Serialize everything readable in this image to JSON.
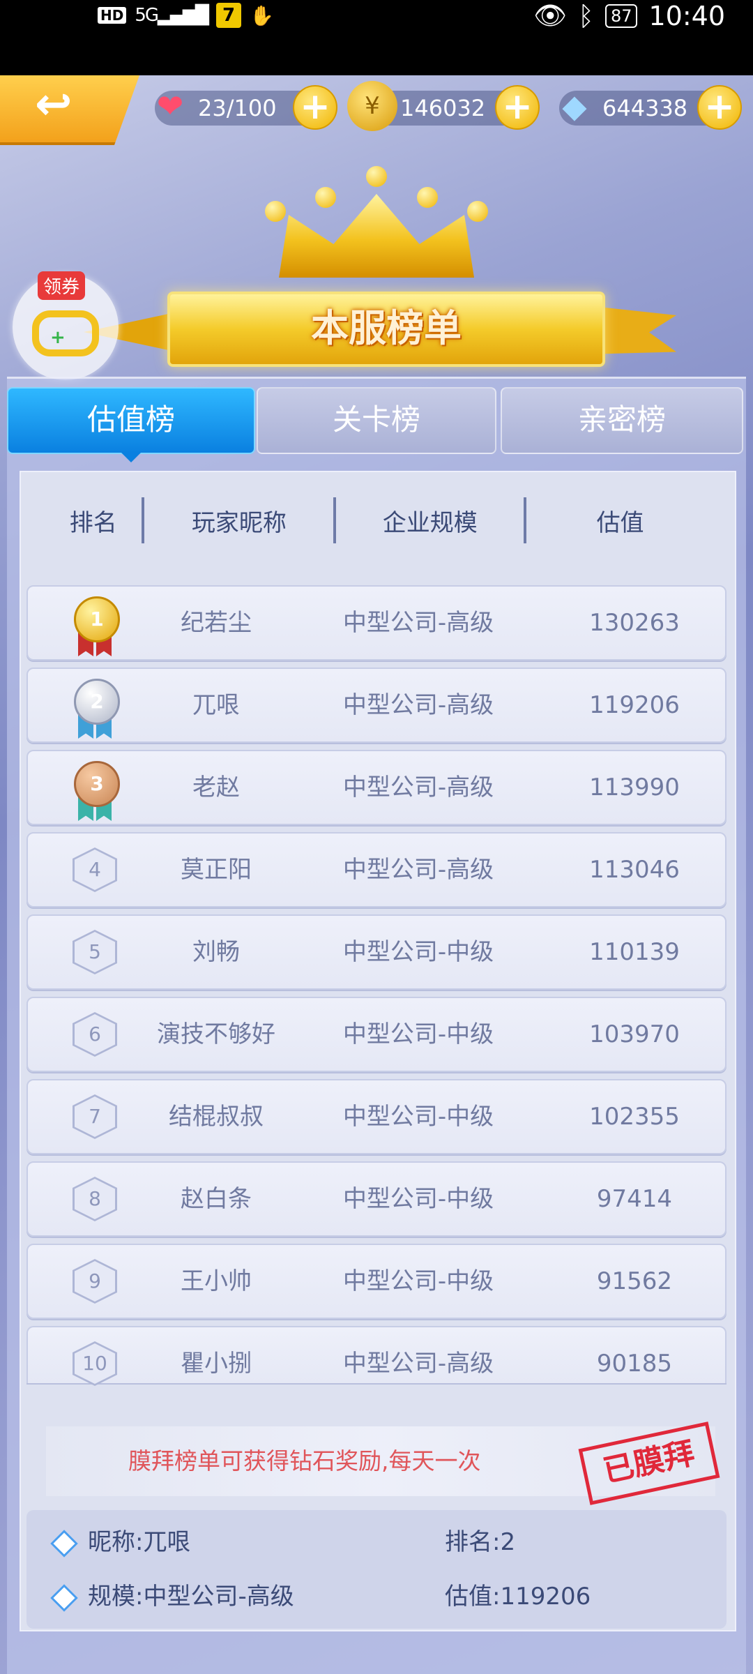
{
  "status_bar": {
    "hd": "HD",
    "signal": "5G",
    "app_badge": "7",
    "battery": "87",
    "time": "10:40"
  },
  "resources": {
    "energy": "23/100",
    "coins": "146032",
    "diamonds": "644338"
  },
  "banner": {
    "title": "本服榜单"
  },
  "coupon": {
    "tag": "领券"
  },
  "tabs": [
    {
      "label": "估值榜",
      "active": true
    },
    {
      "label": "关卡榜",
      "active": false
    },
    {
      "label": "亲密榜",
      "active": false
    }
  ],
  "table": {
    "headers": [
      "排名",
      "玩家昵称",
      "企业规模",
      "估值"
    ],
    "rows": [
      {
        "rank": "1",
        "name": "纪若尘",
        "scale": "中型公司-高级",
        "value": "130263"
      },
      {
        "rank": "2",
        "name": "兀哏",
        "scale": "中型公司-高级",
        "value": "119206"
      },
      {
        "rank": "3",
        "name": "老赵",
        "scale": "中型公司-高级",
        "value": "113990"
      },
      {
        "rank": "4",
        "name": "莫正阳",
        "scale": "中型公司-高级",
        "value": "113046"
      },
      {
        "rank": "5",
        "name": "刘畅",
        "scale": "中型公司-中级",
        "value": "110139"
      },
      {
        "rank": "6",
        "name": "演技不够好",
        "scale": "中型公司-中级",
        "value": "103970"
      },
      {
        "rank": "7",
        "name": "结棍叔叔",
        "scale": "中型公司-中级",
        "value": "102355"
      },
      {
        "rank": "8",
        "name": "赵白条",
        "scale": "中型公司-中级",
        "value": "97414"
      },
      {
        "rank": "9",
        "name": "王小帅",
        "scale": "中型公司-中级",
        "value": "91562"
      },
      {
        "rank": "10",
        "name": "瞿小捌",
        "scale": "中型公司-高级",
        "value": "90185"
      }
    ]
  },
  "notice": {
    "text": "膜拜榜单可获得钻石奖励,每天一次",
    "stamp": "已膜拜"
  },
  "my_info": {
    "nickname_label": "昵称:",
    "nickname": "兀哏",
    "rank_label": "排名:",
    "rank": "2",
    "scale_label": "规模:",
    "scale": "中型公司-高级",
    "value_label": "估值:",
    "value": "119206"
  }
}
